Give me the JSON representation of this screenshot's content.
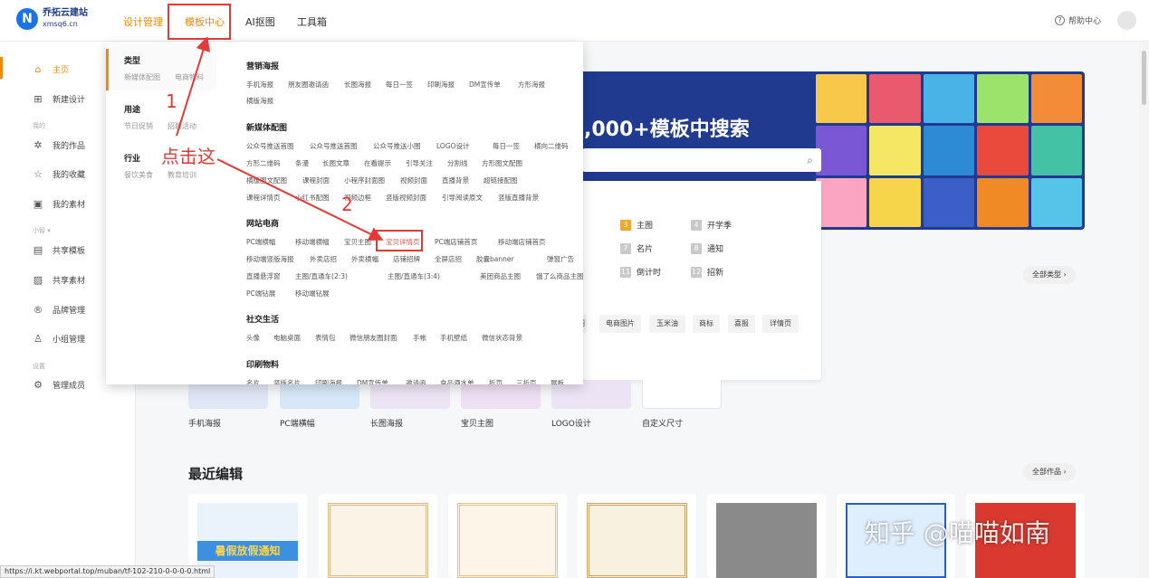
{
  "brand": {
    "name": "乔拓云建站",
    "domain": "xmsq6.cn"
  },
  "nav": {
    "items": [
      "设计管理",
      "模板中心",
      "AI抠图",
      "工具箱"
    ],
    "help": "帮助中心"
  },
  "sidebar": {
    "home": "主页",
    "new_design": "新建设计",
    "group_mine": "我的",
    "my_works": "我的作品",
    "my_favorites": "我的收藏",
    "my_assets": "我的素材",
    "group_team": "小智 ▾",
    "shared_templates": "共享模板",
    "shared_assets": "共享素材",
    "brand_mgmt": "品牌管理",
    "team_mgmt": "小组管理",
    "group_settings": "设置",
    "members": "管理成员"
  },
  "banner": {
    "title": ",000+模板中搜索"
  },
  "type_panel": {
    "tags": [
      {
        "num": "3",
        "label": "主图"
      },
      {
        "num": "4",
        "label": "开学季"
      },
      {
        "num": "7",
        "label": "名片"
      },
      {
        "num": "8",
        "label": "通知"
      },
      {
        "num": "11",
        "label": "倒计时"
      },
      {
        "num": "12",
        "label": "招新"
      }
    ]
  },
  "mini_tags": [
    "图",
    "电商图片",
    "玉米油",
    "商标",
    "喜报",
    "详情页"
  ],
  "all_types": "全部类型 ›",
  "cards": [
    "手机海报",
    "PC端横幅",
    "长图海报",
    "宝贝主图",
    "LOGO设计",
    "自定义尺寸"
  ],
  "recent": {
    "title": "最近编辑",
    "all": "全部作品 ›",
    "item1_text": "暑假放假通知"
  },
  "status_url": "https://i.kt.webportal.top/muban/tf-102-210-0-0-0-0.html",
  "mega": {
    "left": {
      "type_head": "类型",
      "type_sub": [
        "新媒体配图",
        "电商物料"
      ],
      "use_head": "用途",
      "use_sub": [
        "节日促销",
        "招聘活动"
      ],
      "industry_head": "行业",
      "industry_sub": [
        "餐饮美食",
        "教育培训"
      ]
    },
    "sections": {
      "marketing": "营销海报",
      "marketing_links": [
        "手机海报",
        "朋友圈邀请函",
        "长图海报",
        "每日一签",
        "印刷海报",
        "DM宣传单",
        "方形海报",
        "横版海报"
      ],
      "newmedia": "新媒体配图",
      "newmedia_links": [
        "公众号推送首图",
        "公众号推送首图",
        "公众号推送小图",
        "LOGO设计",
        "每日一签",
        "横向二维码",
        "方形二维码",
        "条漫",
        "长图文章",
        "在看提示",
        "引导关注",
        "分割线",
        "方形图文配图",
        "横版图文配图",
        "课程封面",
        "小程序封面图",
        "视频封面",
        "直播背景",
        "超链接配图",
        "课程详情页",
        "小红书配图",
        "视频边框",
        "竖版视频封面",
        "引导阅读原文",
        "竖版直播背景"
      ],
      "ecommerce": "网站电商",
      "ecommerce_links": [
        "PC端横幅",
        "移动端横幅",
        "宝贝主图",
        "宝贝详情页",
        "PC端店铺首页",
        "移动端店铺首页",
        "移动端竖版海报",
        "外卖店招",
        "外卖横幅",
        "店铺招牌",
        "全屏店招",
        "胶囊banner",
        "弹窗广告",
        "直播悬浮窗",
        "主图/直通车(2:3)",
        "主图/直通车(3:4)",
        "美团商品主图",
        "饿了么商品主图",
        "PC端钻展",
        "移动端钻展"
      ],
      "social": "社交生活",
      "social_links": [
        "头像",
        "电脑桌面",
        "表情包",
        "微信朋友圈封面",
        "手帐",
        "手机壁纸",
        "微信状态背景"
      ],
      "print": "印刷物料",
      "print_links": [
        "名片",
        "竖版名片",
        "印刷海报",
        "DM宣传单",
        "邀请函",
        "食品酒水单",
        "折页",
        "三折页",
        "展板"
      ]
    }
  },
  "annotations": {
    "one": "1",
    "two": "2",
    "click_here": "点击这"
  },
  "watermark": "知乎 @喵喵如南",
  "colors": {
    "accent": "#f0880a",
    "annotation": "#e53935",
    "banner": "#1f3a8e"
  }
}
